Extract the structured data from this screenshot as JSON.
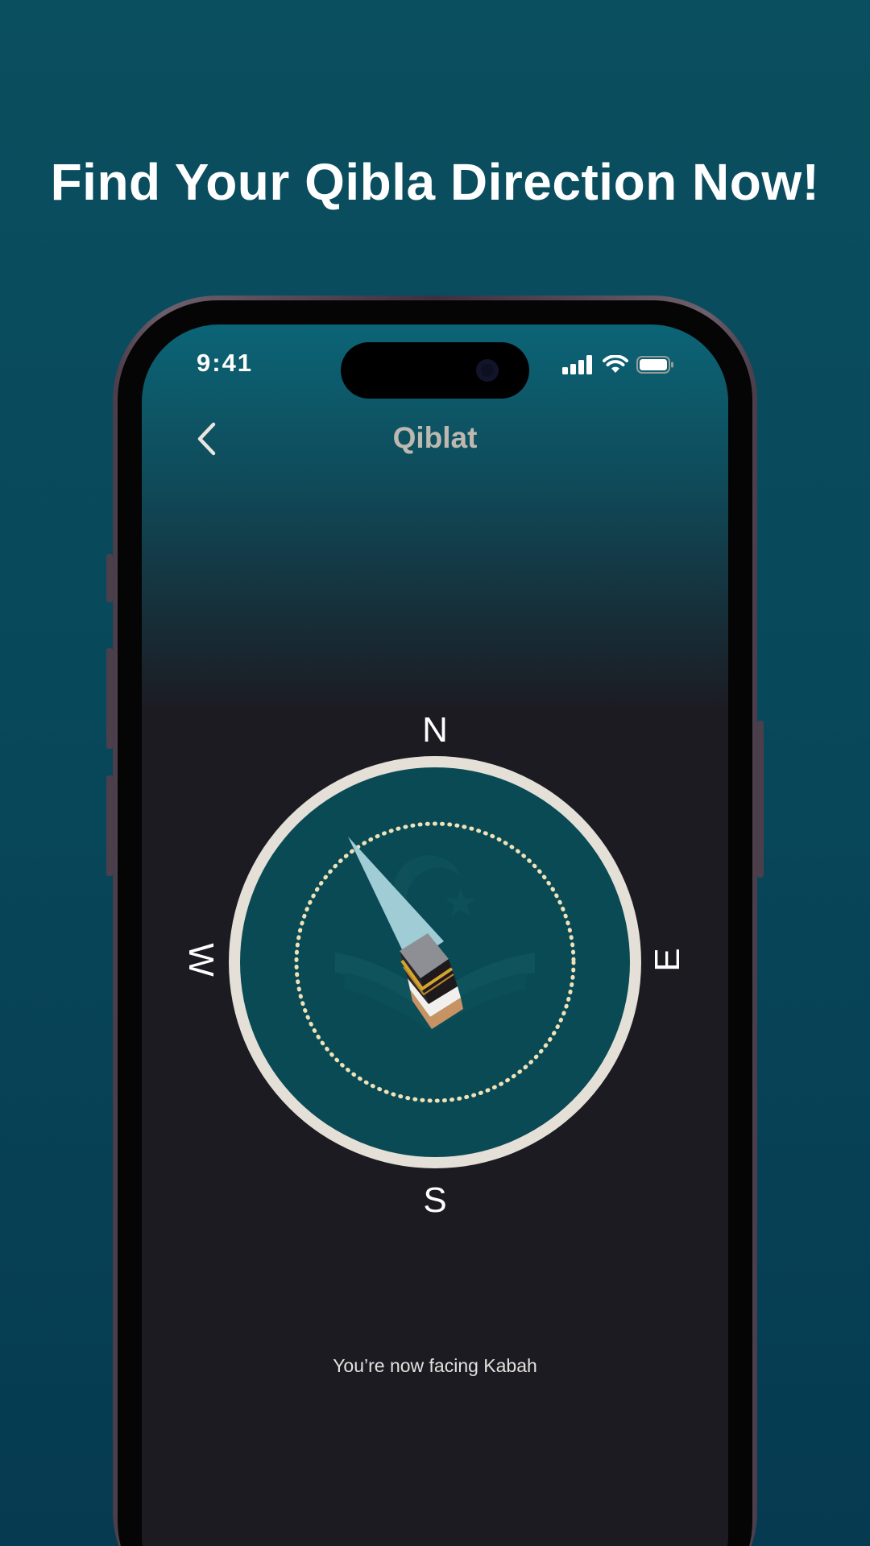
{
  "headline": "Find Your Qibla Direction Now!",
  "status_bar": {
    "time": "9:41",
    "icons": [
      "signal-icon",
      "wifi-icon",
      "battery-icon"
    ]
  },
  "nav": {
    "back_icon": "chevron-left-icon",
    "title": "Qiblat"
  },
  "compass": {
    "north": "N",
    "east": "E",
    "south": "S",
    "west": "W",
    "center_icon": "kaaba-icon",
    "pointer_icon": "qibla-beam-icon"
  },
  "status_message": "You’re now facing Kabah",
  "colors": {
    "background": "#08485b",
    "screen_dark": "#1c1b22",
    "compass_face": "#0a4a55",
    "compass_ring": "#e4e0d7",
    "dotted_ring": "#efe2b8",
    "beam": "#a9d3dc"
  }
}
